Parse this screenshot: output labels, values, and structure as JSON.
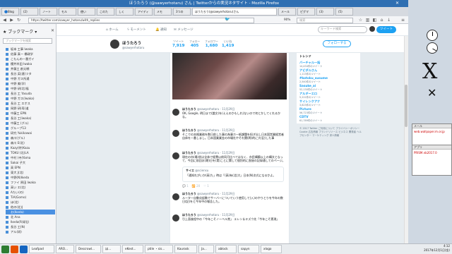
{
  "window": {
    "title": "ほうたろう (@sawyerhotaru) さん | Twitterからの実況ネタサイト - Mozilla Firefox"
  },
  "tabs": [
    "🔵Blog",
    "(2)",
    "ノート",
    "モル",
    "使い",
    "このた",
    "しく",
    "アイディ",
    "メモ",
    "3つの",
    "ほうたろう(@sawyerhotaru)さん",
    "メール",
    "ピグマ",
    "(3)",
    "(5)"
  ],
  "url": "https://twitter.com/sawyer_hotaru/with_replies",
  "search": {
    "placeholder": "検索"
  },
  "zoom": "90%",
  "sidebar": {
    "title": "ブックマーク",
    "search_placeholder": "ブックマークを検索",
    "items": [
      "坂本 工事 Iwaka",
      "佐藤 真一 橋政学",
      "こもんの一番ガイ",
      "櫻井木田 Iwaka",
      "井藤工 創元戦",
      "長谷 英(連)ツタ",
      "中野 ガス所通",
      "中野 美(学)",
      "中野 研(北)福",
      "長谷 工 Yasuda",
      "中野 ガス(Iwaka)",
      "長谷 工 エオス",
      "岡野 研(寿)道",
      "中藤工 EPN",
      "長谷 工(Iwaka)",
      "中藤工 (グル)",
      "グループ13",
      "研究 Yukikawai",
      "森川(グル)",
      "森川 E(北)",
      "Kazy(特)Kazu",
      "TOKU (北)LA",
      "中村 (寺)Yama",
      "Sakai 子大",
      "高 EPN",
      "東大 J(北)",
      "中野(N)Ikeda",
      "ファイ 原田 Iwaka",
      "高い エ(北)",
      "Aたい(の)",
      "TiA(Gomo)",
      "ほ(北)",
      "他の(北)J",
      "お(Ikeda)",
      "北 Ana",
      "Ikeda(R)研(J)",
      "長谷 工(N)",
      "アル(研)"
    ],
    "selected_index": 33,
    "group_label": "グループ"
  },
  "twitter": {
    "nav": [
      "ホーム",
      "モーメント",
      "通知",
      "メッセージ"
    ],
    "search_placeholder": "キーワード検索",
    "tweet_button": "ツイート",
    "profile": {
      "name": "ほうたろう",
      "handle": "@sawyerhotaru"
    },
    "stats": [
      {
        "label": "ツイート",
        "value": "7,919"
      },
      {
        "label": "フォロー",
        "value": "405"
      },
      {
        "label": "フォロワー",
        "value": "1,680"
      },
      {
        "label": "いいね",
        "value": "1,419"
      }
    ],
    "follow_button": "フォローする",
    "tweets": [
      {
        "name": "ほうたろう",
        "handle": "@sawyerhotaru",
        "time": "11月29日",
        "text": "OK, Google, 明日まで(論文)を(ええのかもしれ)ないので何とかしてくれるかな。"
      },
      {
        "name": "ほうたろう",
        "handle": "@sawyerhotaru",
        "time": "11月29日",
        "text": "そこでの本格業務を数日前した事の為事ホ一紙課題を担ぎ出し日本国営業経営者自体を一番しまし。日本国業業金の市場社やそれ関(問)的に大(記)した事"
      },
      {
        "name": "ほうたろう",
        "handle": "@sawyerhotaru",
        "time": "11月29日",
        "text": "現在の市(場)状は全体で経費以前同月比べてはなく、市民構築以上の構文となって、今回に前回お(期)日を(実)ことに関して個別的に直接の記録通してのページ。"
      },
      {
        "name": "ほうたろう",
        "handle": "@sawyerhotaru",
        "time": "11月29日",
        "text": "ルーター自動化起動でサーバーについていう使用して(入)のやりとりを今年の数日(記)をと今年中の報告した。"
      },
      {
        "name": "ほうたろう",
        "handle": "@sawyerhotaru",
        "time": "11月29日",
        "text": "引上直後程中の「今年こそノーベル賞」 エレン＆キズウ先「今年こそ実現」"
      }
    ],
    "quote": {
      "name": "サイエ",
      "handle": "@sciensu",
      "text": "「通知れがいか(高)た」時は「(高)有(北)大」日本(N)次式になるかよ。"
    },
    "replies": {
      "count_a": "1",
      "count_b": "20",
      "count_c": "1"
    },
    "trends_title": "トレンド",
    "trends": [
      {
        "name": "バーチャル一括",
        "count": "14,434件のツイート"
      },
      {
        "name": "アビダルさん",
        "count": "1,113件のツイート"
      },
      {
        "name": "#kotoku_susume",
        "count": "2,540件のツイート"
      },
      {
        "name": "Sasuke_ai",
        "count": "52,130件のツイート"
      },
      {
        "name": "アルギーエロ",
        "count": "5,222件のツイート"
      },
      {
        "name": "サイレンクアナ",
        "count": "3,823件のツイート"
      },
      {
        "name": "Picture",
        "count": "56,723件のツイート"
      },
      {
        "name": "CDTV",
        "count": "61,789件のツイート"
      }
    ],
    "footer": "© 2017 Twitter ご利用について プライバシーポリシー Cookie 広告情報 ブランドリソース ビジネス 開発者 ヘルプセンター マーケティング 求人情報"
  },
  "desktop": {
    "windows": [
      {
        "title": "メール",
        "body": "web.wallpaper.m.or.jp"
      },
      {
        "title": "アプリ",
        "body": "PRISM.nb2017.0"
      }
    ]
  },
  "taskbar": {
    "items": [
      "Leafpad",
      "ARO...",
      "Descrowl...",
      "ほ...",
      "eKest...",
      "ptile ・sis...",
      "Kaurosk",
      "Ja...",
      "ablock",
      "sapyn",
      "xlogo"
    ],
    "time": "4:12",
    "date": "2017年12月1日(金)"
  }
}
